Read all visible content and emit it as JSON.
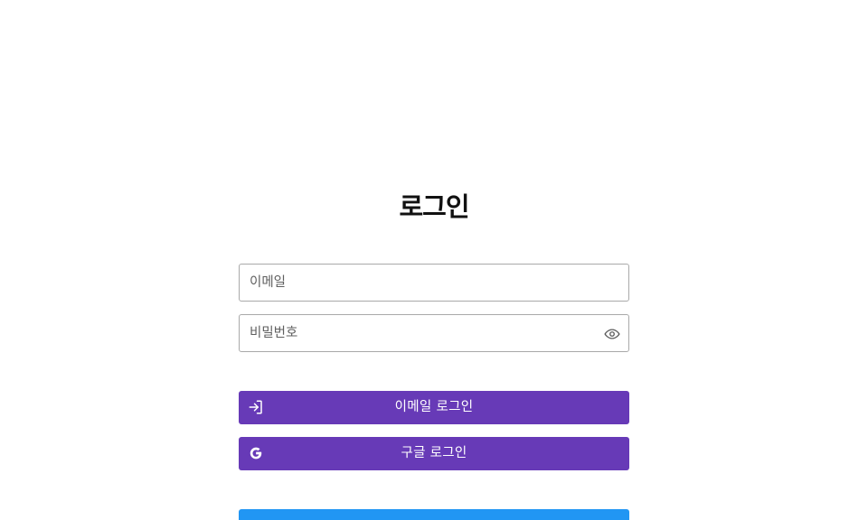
{
  "colors": {
    "primary": "#673ab7",
    "secondary": "#2196f3",
    "input_border": "#a9a9a9",
    "text": "#111111"
  },
  "login": {
    "title": "로그인",
    "email": {
      "placeholder": "이메일",
      "value": ""
    },
    "password": {
      "placeholder": "비밀번호",
      "value": "",
      "toggle_icon": "eye-icon"
    },
    "email_login_button": {
      "label": "이메일 로그인",
      "icon": "login-icon"
    },
    "google_login_button": {
      "label": "구글 로그인",
      "icon": "google-icon"
    },
    "signup_button": {
      "label": ""
    }
  }
}
